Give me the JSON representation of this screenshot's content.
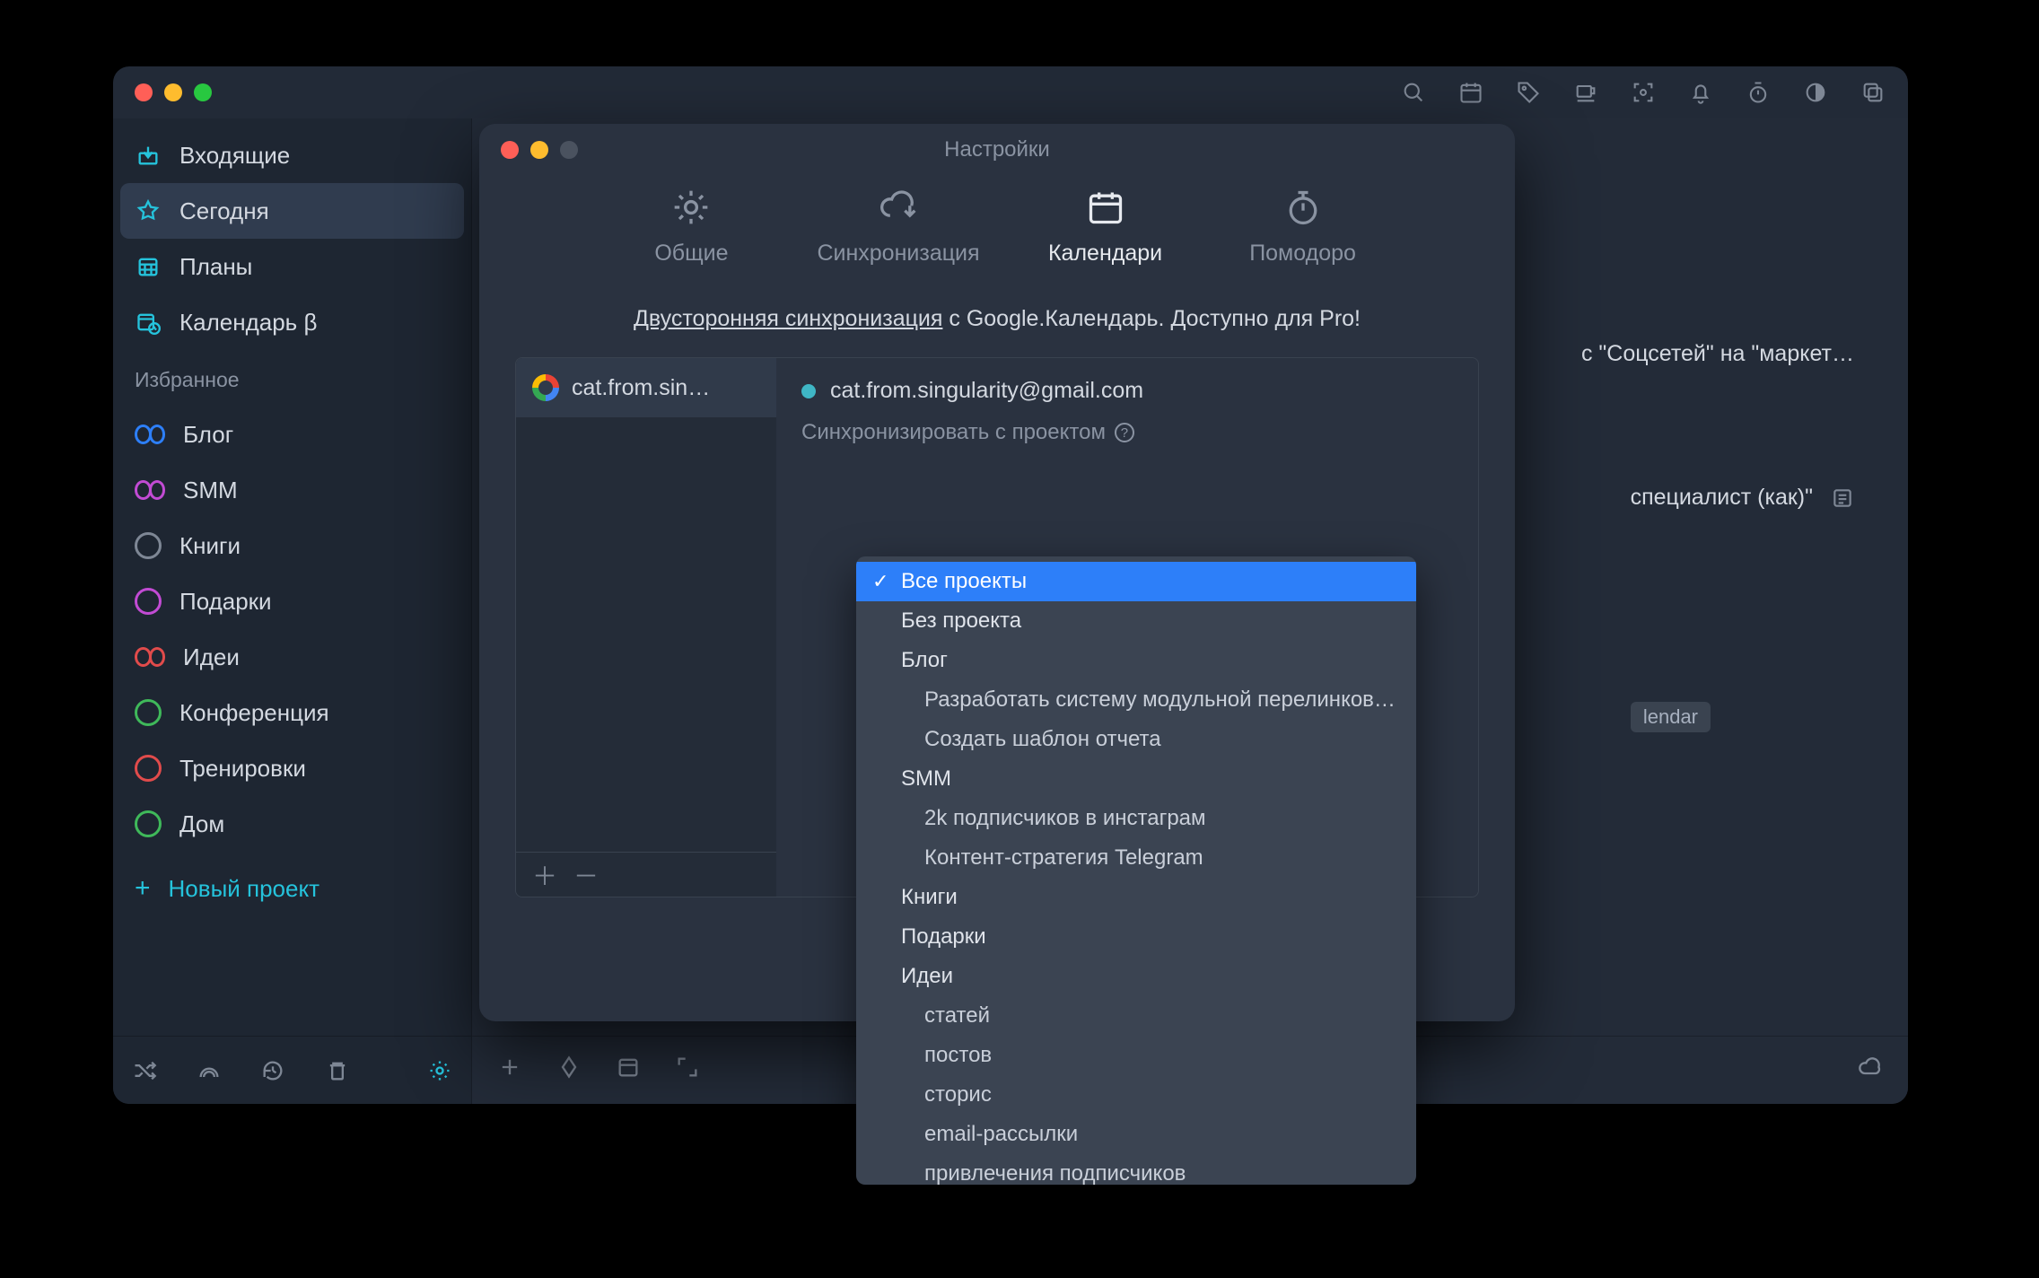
{
  "main_window": {
    "toolbar_icons": [
      "search",
      "calendar",
      "tag",
      "cup",
      "focus",
      "bell",
      "timer",
      "contrast",
      "copy"
    ],
    "sidebar": {
      "nav": [
        {
          "id": "inbox",
          "label": "Входящие",
          "icon": "inbox",
          "color": "#25c3dc"
        },
        {
          "id": "today",
          "label": "Сегодня",
          "icon": "star",
          "color": "#25c3dc",
          "selected": true
        },
        {
          "id": "plans",
          "label": "Планы",
          "icon": "calendar-grid",
          "color": "#25c3dc"
        },
        {
          "id": "calendar",
          "label": "Календарь β",
          "icon": "calendar-clock",
          "color": "#25c3dc"
        }
      ],
      "favorites_header": "Избранное",
      "projects": [
        {
          "id": "blog",
          "label": "Блог",
          "shape": "infinity",
          "color": "#2d7ff9"
        },
        {
          "id": "smm",
          "label": "SMM",
          "shape": "infinity",
          "color": "#c24bd4"
        },
        {
          "id": "books",
          "label": "Книги",
          "shape": "circle",
          "color": "#7e8795"
        },
        {
          "id": "gifts",
          "label": "Подарки",
          "shape": "circle",
          "color": "#c24bd4"
        },
        {
          "id": "ideas",
          "label": "Идеи",
          "shape": "infinity",
          "color": "#e14b4b"
        },
        {
          "id": "conference",
          "label": "Конференция",
          "shape": "circle",
          "color": "#3fb95a"
        },
        {
          "id": "workouts",
          "label": "Тренировки",
          "shape": "circle",
          "color": "#e14b4b"
        },
        {
          "id": "home",
          "label": "Дом",
          "shape": "circle",
          "color": "#3fb95a"
        }
      ],
      "new_project_label": "Новый проект"
    },
    "content": {
      "snippet1": "с \"Соцсетей\" на \"маркет…",
      "snippet2": "специалист (как)\"",
      "tag": "lendar"
    }
  },
  "settings_window": {
    "title": "Настройки",
    "tabs": [
      {
        "id": "general",
        "label": "Общие",
        "icon": "gear"
      },
      {
        "id": "sync",
        "label": "Синхронизация",
        "icon": "sync-cloud"
      },
      {
        "id": "calendars",
        "label": "Календари",
        "icon": "calendar",
        "active": true
      },
      {
        "id": "pomodoro",
        "label": "Помодоро",
        "icon": "stopwatch"
      }
    ],
    "note_link": "Двусторонняя синхронизация",
    "note_rest": " с Google.Календарь. Доступно для Pro!",
    "account_short": "cat.from.sin…",
    "account_email": "cat.from.singularity@gmail.com",
    "sync_with_label": "Синхронизировать с проектом"
  },
  "dropdown": {
    "items": [
      {
        "label": "Все проекты",
        "selected": true
      },
      {
        "label": "Без проекта"
      },
      {
        "label": "Блог"
      },
      {
        "label": "Разработать систему модульной перелинков…",
        "indent": 1
      },
      {
        "label": "Создать шаблон отчета",
        "indent": 1
      },
      {
        "label": "SMM"
      },
      {
        "label": "2k подписчиков в инстаграм",
        "indent": 1
      },
      {
        "label": "Контент-стратегия Telegram",
        "indent": 1
      },
      {
        "label": "Книги"
      },
      {
        "label": "Подарки"
      },
      {
        "label": "Идеи"
      },
      {
        "label": "статей",
        "indent": 1
      },
      {
        "label": "постов",
        "indent": 1
      },
      {
        "label": "сторис",
        "indent": 1
      },
      {
        "label": "email-рассылки",
        "indent": 1
      },
      {
        "label": "привлечения подписчиков",
        "indent": 1
      }
    ]
  }
}
